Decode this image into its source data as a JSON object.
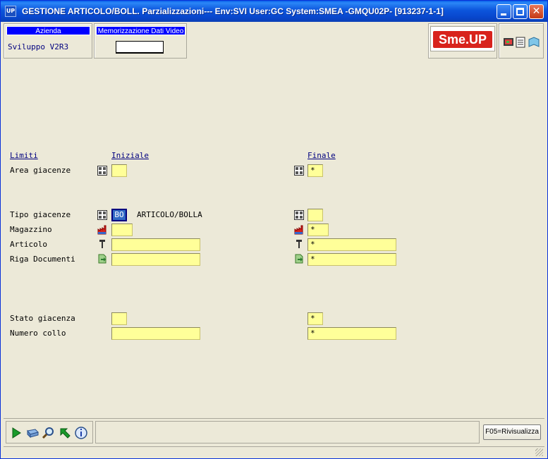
{
  "window": {
    "app_icon": "UP",
    "title": "GESTIONE ARTICOLO/BOLL.  Parzializzazioni--- Env:SVI User:GC System:SMEA -GMQU02P- [913237-1-1]"
  },
  "header": {
    "azienda_label": "Azienda",
    "azienda_value": "Sviluppo V2R3",
    "memo_label": "Memorizzazione Dati Video",
    "memo_value": "",
    "logo_text": "Sme.UP"
  },
  "form": {
    "col_limiti": "Limiti",
    "col_iniziale": "Iniziale",
    "col_finale": "Finale",
    "rows": [
      {
        "label": "Area giacenze",
        "initial": "",
        "final": "*"
      },
      {
        "label": "Tipo giacenze",
        "initial": "BO",
        "initial_desc": "ARTICOLO/BOLLA",
        "final": ""
      },
      {
        "label": "Magazzino",
        "initial": "",
        "final": "*"
      },
      {
        "label": "Articolo",
        "initial": "",
        "final": "*"
      },
      {
        "label": "Riga Documenti",
        "initial": "",
        "final": "*"
      },
      {
        "label": "Stato giacenza",
        "initial": "",
        "final": "*"
      },
      {
        "label": "Numero collo",
        "initial": "",
        "final": "*"
      }
    ]
  },
  "toolbar": {
    "icons": [
      "play-icon",
      "box-icon",
      "search-icon",
      "back-arrow-icon",
      "info-icon"
    ],
    "f05_label": "F05=Rivisualizza"
  },
  "colors": {
    "field_bg": "#ffff99",
    "header_label_bg": "#0000ff",
    "title_bar": "#0846cc",
    "logo_red": "#d8231c"
  }
}
